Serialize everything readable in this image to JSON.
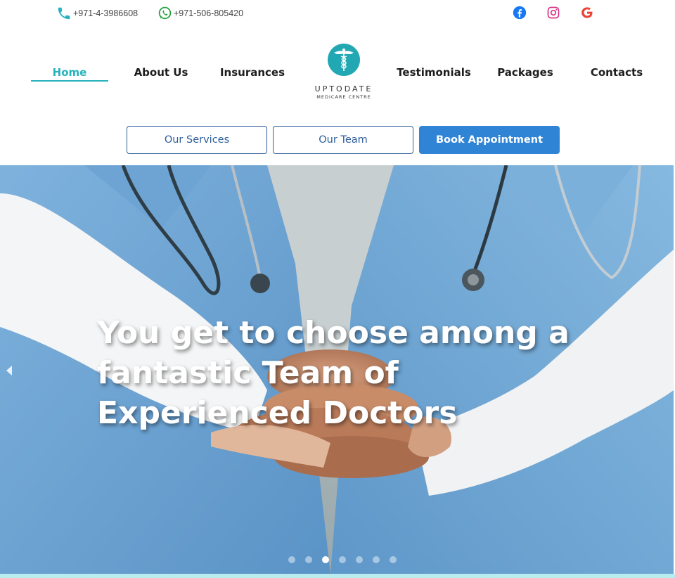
{
  "contact": {
    "phone": "+971-4-3986608",
    "whatsapp": "+971-506-805420"
  },
  "social": {
    "facebook_icon": "facebook-icon",
    "instagram_icon": "instagram-icon",
    "google_icon": "google-icon"
  },
  "nav": {
    "home": "Home",
    "about": "About Us",
    "insurances": "Insurances",
    "testimonials": "Testimonials",
    "packages": "Packages",
    "contacts": "Contacts"
  },
  "logo": {
    "name": "UPTODATE",
    "subtitle": "MEDICARE CENTRE"
  },
  "buttons": {
    "services": "Our Services",
    "team": "Our Team",
    "book": "Book Appointment"
  },
  "hero": {
    "headline": "You get to choose among a fantastic Team of Experienced Doctors",
    "slide_count": 7,
    "active_slide": 3
  },
  "colors": {
    "accent": "#27b3bd",
    "primary_button": "#2f84d6",
    "outline_button": "#2e5e9a"
  }
}
